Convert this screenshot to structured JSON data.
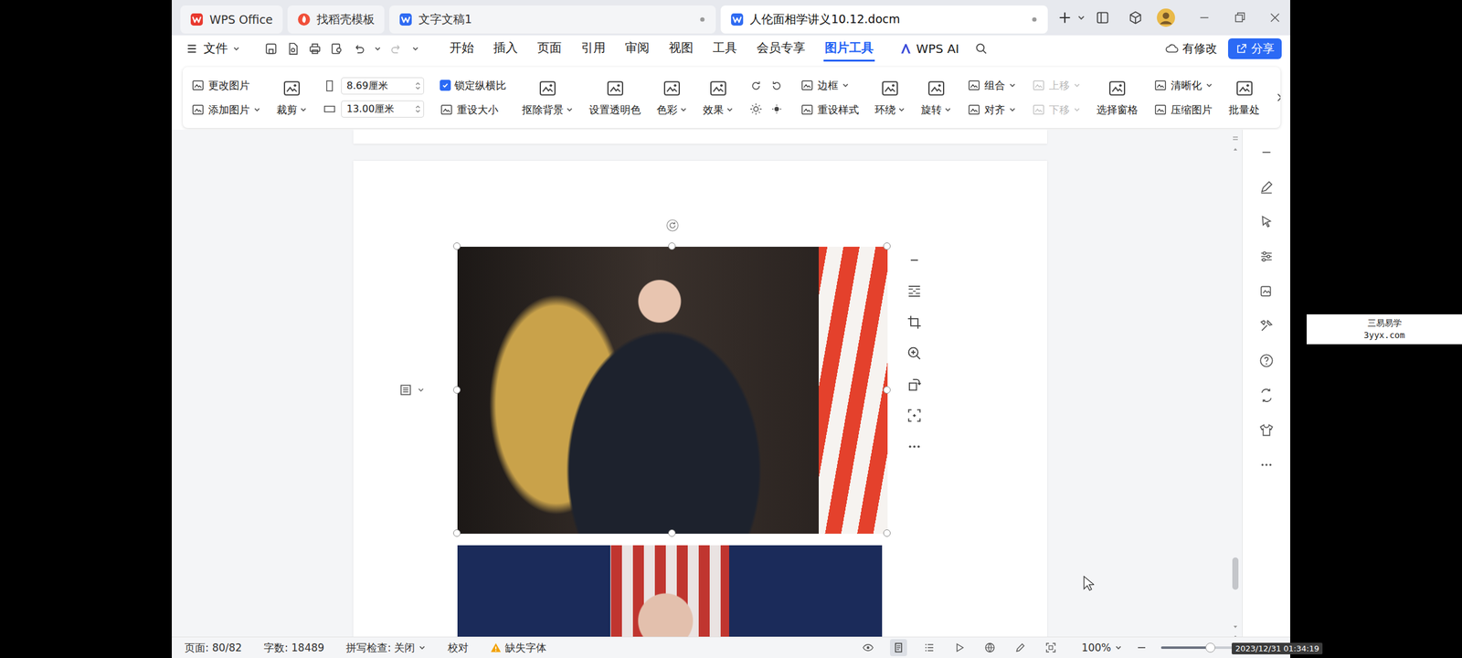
{
  "window": {
    "tabs": [
      {
        "label": "WPS Office",
        "kind": "app",
        "selected": false
      },
      {
        "label": "找稻壳模板",
        "kind": "template",
        "selected": false
      },
      {
        "label": "文字文稿1",
        "kind": "doc",
        "selected": false
      },
      {
        "label": "人伦面相学讲义10.12.docm",
        "kind": "doc",
        "selected": true
      }
    ]
  },
  "menu": {
    "file": "文件",
    "items": [
      {
        "label": "开始",
        "selected": false
      },
      {
        "label": "插入",
        "selected": false
      },
      {
        "label": "页面",
        "selected": false
      },
      {
        "label": "引用",
        "selected": false
      },
      {
        "label": "审阅",
        "selected": false
      },
      {
        "label": "视图",
        "selected": false
      },
      {
        "label": "工具",
        "selected": false
      },
      {
        "label": "会员专享",
        "selected": false
      },
      {
        "label": "图片工具",
        "selected": true
      }
    ],
    "ai": "WPS AI",
    "modified": "有修改",
    "share": "分享"
  },
  "ribbon": {
    "groups": [
      {
        "kind": "stack",
        "items": [
          {
            "kind": "button",
            "label": "更改图片",
            "dropdown": false,
            "disabled": false
          },
          {
            "kind": "button",
            "label": "添加图片",
            "dropdown": true,
            "disabled": false
          }
        ]
      },
      {
        "kind": "big",
        "label": "裁剪",
        "dropdown": true
      },
      {
        "kind": "size",
        "fields": [
          {
            "value": "8.69厘米"
          },
          {
            "value": "13.00厘米"
          }
        ]
      },
      {
        "kind": "stack",
        "items": [
          {
            "kind": "checkbox",
            "label": "锁定纵横比",
            "checked": true,
            "dropdown": false,
            "disabled": false
          },
          {
            "kind": "button",
            "label": "重设大小",
            "dropdown": false,
            "disabled": false
          }
        ]
      },
      {
        "kind": "big",
        "label": "抠除背景",
        "dropdown": true
      },
      {
        "kind": "big",
        "label": "设置透明色",
        "dropdown": false
      },
      {
        "kind": "big",
        "label": "色彩",
        "dropdown": true
      },
      {
        "kind": "big",
        "label": "效果",
        "dropdown": true
      },
      {
        "kind": "icon-grid"
      },
      {
        "kind": "stack",
        "items": [
          {
            "kind": "button",
            "label": "边框",
            "dropdown": true,
            "disabled": false
          },
          {
            "kind": "button",
            "label": "重设样式",
            "dropdown": false,
            "disabled": false
          }
        ]
      },
      {
        "kind": "big",
        "label": "环绕",
        "dropdown": true
      },
      {
        "kind": "big",
        "label": "旋转",
        "dropdown": true
      },
      {
        "kind": "stack",
        "items": [
          {
            "kind": "button",
            "label": "组合",
            "dropdown": true,
            "disabled": false
          },
          {
            "kind": "button",
            "label": "对齐",
            "dropdown": true,
            "disabled": false
          }
        ]
      },
      {
        "kind": "stack",
        "items": [
          {
            "kind": "button",
            "label": "上移",
            "dropdown": true,
            "disabled": true
          },
          {
            "kind": "button",
            "label": "下移",
            "dropdown": true,
            "disabled": true
          }
        ]
      },
      {
        "kind": "big",
        "label": "选择窗格",
        "dropdown": false
      },
      {
        "kind": "stack",
        "items": [
          {
            "kind": "button",
            "label": "清晰化",
            "dropdown": true,
            "disabled": false
          },
          {
            "kind": "button",
            "label": "压缩图片",
            "dropdown": false,
            "disabled": false
          }
        ]
      },
      {
        "kind": "big",
        "label": "批量处",
        "dropdown": false
      }
    ]
  },
  "document": {
    "images": [
      {
        "selected": true
      },
      {
        "selected": false
      }
    ]
  },
  "scrollbar": {
    "level": 0.93
  },
  "status_bar": {
    "page": "页面: 80/82",
    "words": "字数: 18489",
    "spell": "拼写检查: 关闭",
    "proofread": "校对",
    "missing_font": "缺失字体",
    "view_buttons": [
      {
        "selected": false
      },
      {
        "selected": true
      },
      {
        "selected": false
      },
      {
        "selected": false
      },
      {
        "selected": false
      },
      {
        "selected": false
      },
      {
        "selected": false
      }
    ],
    "zoom": "100%",
    "zoom_level": 0.52
  },
  "overlays": {
    "watermark": [
      "三易易学",
      "3yyx.com"
    ],
    "timestamp": "2023/12/31 01:34:19"
  }
}
